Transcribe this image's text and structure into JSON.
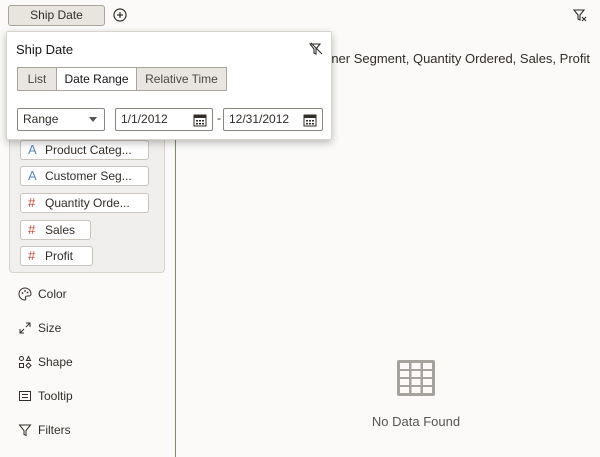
{
  "filter_bar": {
    "pill_label": "Ship Date"
  },
  "popup": {
    "title": "Ship Date",
    "segments": [
      "List",
      "Date Range",
      "Relative Time"
    ],
    "active_segment": "Date Range",
    "range_select": "Range",
    "start_date": "1/1/2012",
    "end_date": "12/31/2012",
    "dash": "-"
  },
  "fields": [
    {
      "label": "Product Categ...",
      "kind": "attribute",
      "icon": "A"
    },
    {
      "label": "Customer Seg...",
      "kind": "attribute",
      "icon": "A"
    },
    {
      "label": "Quantity Orde...",
      "kind": "measure",
      "icon": "#"
    },
    {
      "label": "Sales",
      "kind": "measure",
      "icon": "#"
    },
    {
      "label": "Profit",
      "kind": "measure",
      "icon": "#"
    }
  ],
  "properties": [
    "Color",
    "Size",
    "Shape",
    "Tooltip",
    "Filters"
  ],
  "canvas": {
    "title": "ner Segment, Quantity Ordered, Sales, Profit",
    "empty_message": "No Data Found"
  },
  "colors": {
    "attribute_icon": "#5b87b8",
    "measure_icon": "#c74634",
    "divider": "#7f8b6a"
  }
}
